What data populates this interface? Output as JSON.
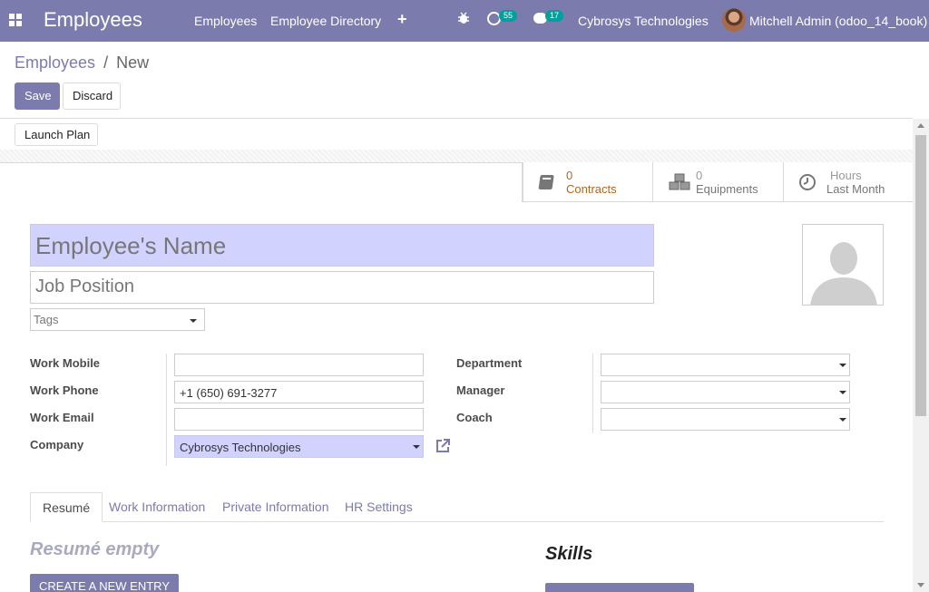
{
  "navbar": {
    "brand": "Employees",
    "menu": [
      "Employees",
      "Employee Directory"
    ],
    "activity_count": "55",
    "message_count": "17",
    "company": "Cybrosys Technologies",
    "user": "Mitchell Admin (odoo_14_book)"
  },
  "breadcrumb": {
    "parent": "Employees",
    "separator": "/",
    "current": "New"
  },
  "buttons": {
    "save": "Save",
    "discard": "Discard",
    "launch_plan": "Launch Plan"
  },
  "stat_buttons": [
    {
      "value": "0",
      "label": "Contracts"
    },
    {
      "value": "0",
      "label": "Equipments"
    },
    {
      "value": "Hours",
      "label": "Last Month"
    }
  ],
  "form": {
    "name_placeholder": "Employee's Name",
    "job_placeholder": "Job Position",
    "tags_placeholder": "Tags",
    "left_labels": [
      "Work Mobile",
      "Work Phone",
      "Work Email",
      "Company"
    ],
    "right_labels": [
      "Department",
      "Manager",
      "Coach"
    ],
    "work_mobile": "",
    "work_phone": "+1 (650) 691-3277",
    "work_email": "",
    "company": "Cybrosys Technologies",
    "department": "",
    "manager": "",
    "coach": ""
  },
  "tabs": [
    "Resumé",
    "Work Information",
    "Private Information",
    "HR Settings"
  ],
  "resume": {
    "empty_text": "Resumé empty",
    "create_button": "CREATE A NEW ENTRY"
  },
  "skills": {
    "title": "Skills"
  },
  "colors": {
    "primary": "#7c7bad",
    "badge": "#00a09d",
    "highlight": "#d2d2ff",
    "stat_orange": "#b5651d"
  }
}
